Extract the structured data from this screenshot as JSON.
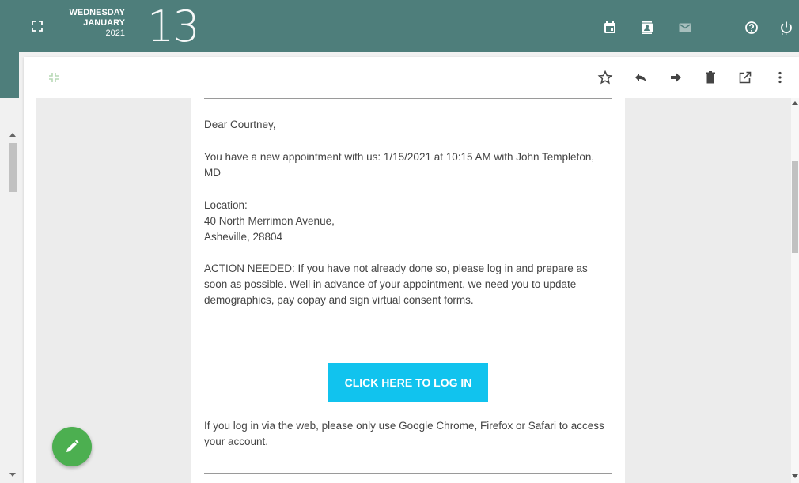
{
  "header": {
    "weekday": "WEDNESDAY",
    "month": "JANUARY",
    "year": "2021",
    "day": "13",
    "icons": [
      "expand-icon",
      "calendar-icon",
      "contacts-icon",
      "mail-icon",
      "help-icon",
      "power-icon"
    ],
    "bg_color": "#4e7e7b"
  },
  "toolbar": {
    "icons": [
      "collapse-icon",
      "star-icon",
      "reply-icon",
      "forward-icon",
      "trash-icon",
      "open-external-icon",
      "more-vert-icon"
    ]
  },
  "email": {
    "greeting": "Dear Courtney,",
    "appointment_line1": "You have a new appointment with us: 1/15/2021 at 10:15 AM with John Templeton,",
    "appointment_line2": "MD",
    "location_label": "Location:",
    "address_line1": "40 North Merrimon Avenue,",
    "address_line2": "Asheville, 28804",
    "action_line1": "ACTION NEEDED: If you have not already done so, please log in and prepare as",
    "action_line2": "soon as possible. Well in advance of your appointment, we need you to update",
    "action_line3": "demographics, pay copay and sign virtual consent forms.",
    "cta_label": "CLICK HERE TO LOG IN",
    "cta_color": "#11c3ee",
    "browser_line1": "If you log in via the web, please only use Google Chrome, Firefox or Safari to access",
    "browser_line2": "your account."
  },
  "fab": {
    "icon": "pencil-icon",
    "color": "#4caf50"
  }
}
